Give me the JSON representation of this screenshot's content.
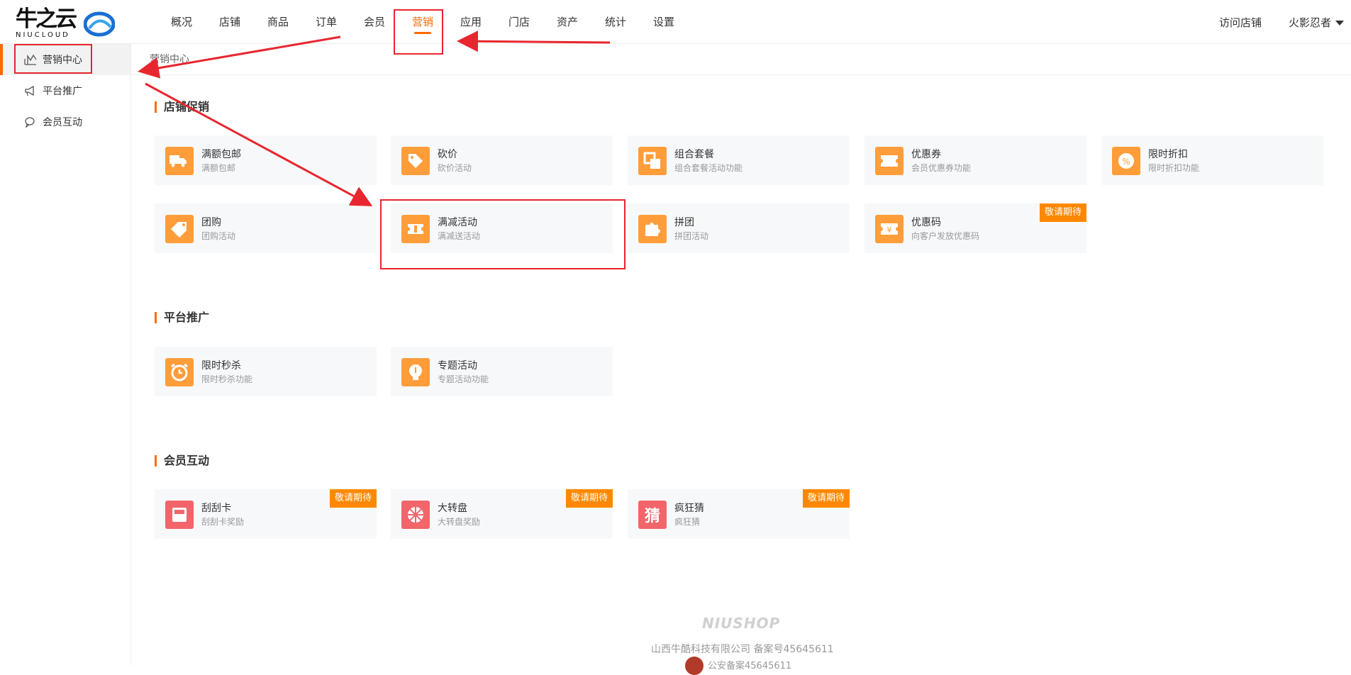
{
  "header": {
    "logo_cn": "牛之云",
    "logo_en": "NIUCLOUD",
    "nav": [
      "概况",
      "店铺",
      "商品",
      "订单",
      "会员",
      "营销",
      "应用",
      "门店",
      "资产",
      "统计",
      "设置"
    ],
    "active_nav": "营销",
    "visit_store": "访问店铺",
    "user": "火影忍者"
  },
  "sidebar": {
    "items": [
      {
        "label": "营销中心",
        "icon": "chart-icon"
      },
      {
        "label": "平台推广",
        "icon": "megaphone-icon"
      },
      {
        "label": "会员互动",
        "icon": "chat-icon"
      }
    ]
  },
  "breadcrumb": "营销中心",
  "sections": [
    {
      "title": "店铺促销",
      "cards": [
        {
          "name": "满额包邮",
          "desc": "满额包邮",
          "icon": "truck-icon",
          "color": "#ff9d3a"
        },
        {
          "name": "砍价",
          "desc": "砍价活动",
          "icon": "tag-icon",
          "color": "#ff9d3a"
        },
        {
          "name": "组合套餐",
          "desc": "组合套餐活动功能",
          "icon": "combo-icon",
          "color": "#ff9d3a"
        },
        {
          "name": "优惠券",
          "desc": "会员优惠券功能",
          "icon": "coupon-icon",
          "color": "#ff9d3a"
        },
        {
          "name": "限时折扣",
          "desc": "限时折扣功能",
          "icon": "percent-icon",
          "color": "#ff9d3a"
        },
        {
          "name": "团购",
          "desc": "团购活动",
          "icon": "label-icon",
          "color": "#ff9d3a"
        },
        {
          "name": "满减活动",
          "desc": "满减送活动",
          "icon": "ticket-icon",
          "color": "#ff9d3a"
        },
        {
          "name": "拼团",
          "desc": "拼团活动",
          "icon": "puzzle-icon",
          "color": "#ff9d3a"
        },
        {
          "name": "优惠码",
          "desc": "向客户发放优惠码",
          "icon": "yen-ticket-icon",
          "color": "#ff9d3a",
          "badge": "敬请期待"
        }
      ]
    },
    {
      "title": "平台推广",
      "cards": [
        {
          "name": "限时秒杀",
          "desc": "限时秒杀功能",
          "icon": "alarm-icon",
          "color": "#ff9d3a"
        },
        {
          "name": "专题活动",
          "desc": "专题活动功能",
          "icon": "bulb-icon",
          "color": "#ff9d3a"
        }
      ]
    },
    {
      "title": "会员互动",
      "cards": [
        {
          "name": "刮刮卡",
          "desc": "刮刮卡奖励",
          "icon": "scratch-icon",
          "color": "#f2656a",
          "badge": "敬请期待"
        },
        {
          "name": "大转盘",
          "desc": "大转盘奖励",
          "icon": "wheel-icon",
          "color": "#f2656a",
          "badge": "敬请期待"
        },
        {
          "name": "疯狂猜",
          "desc": "疯狂猜",
          "icon": "guess-icon",
          "color": "#f2656a",
          "badge": "敬请期待",
          "glyph": "猜"
        }
      ]
    }
  ],
  "footer": {
    "brand": "NIUSHOP",
    "company": "山西牛酷科技有限公司  备案号45645611",
    "police": "公安备案45645611"
  }
}
